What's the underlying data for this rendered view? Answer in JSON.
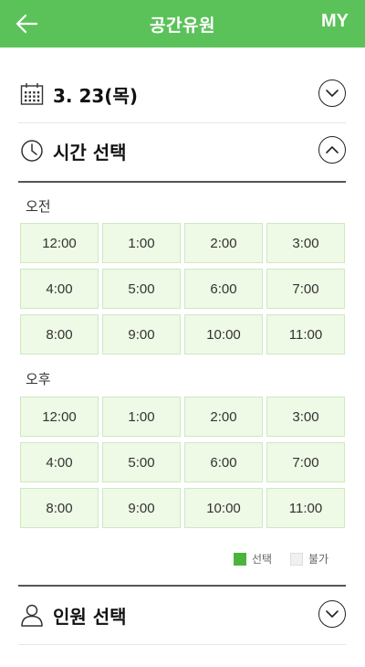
{
  "header": {
    "title": "공간유원",
    "my_label": "MY"
  },
  "date_row": {
    "label": "3. 23(목)"
  },
  "time_row": {
    "label": "시간 선택"
  },
  "morning": {
    "label": "오전",
    "slots": [
      "12:00",
      "1:00",
      "2:00",
      "3:00",
      "4:00",
      "5:00",
      "6:00",
      "7:00",
      "8:00",
      "9:00",
      "10:00",
      "11:00"
    ]
  },
  "afternoon": {
    "label": "오후",
    "slots": [
      "12:00",
      "1:00",
      "2:00",
      "3:00",
      "4:00",
      "5:00",
      "6:00",
      "7:00",
      "8:00",
      "9:00",
      "10:00",
      "11:00"
    ]
  },
  "legend": {
    "selected_label": "선택",
    "unavailable_label": "불가"
  },
  "people_row": {
    "label": "인원 선택"
  },
  "colors": {
    "accent": "#5bc25a",
    "slot_bg": "#eef9e6",
    "slot_border": "#cfe8c2",
    "selected": "#4cb43c",
    "unavailable": "#f0f0f0"
  }
}
